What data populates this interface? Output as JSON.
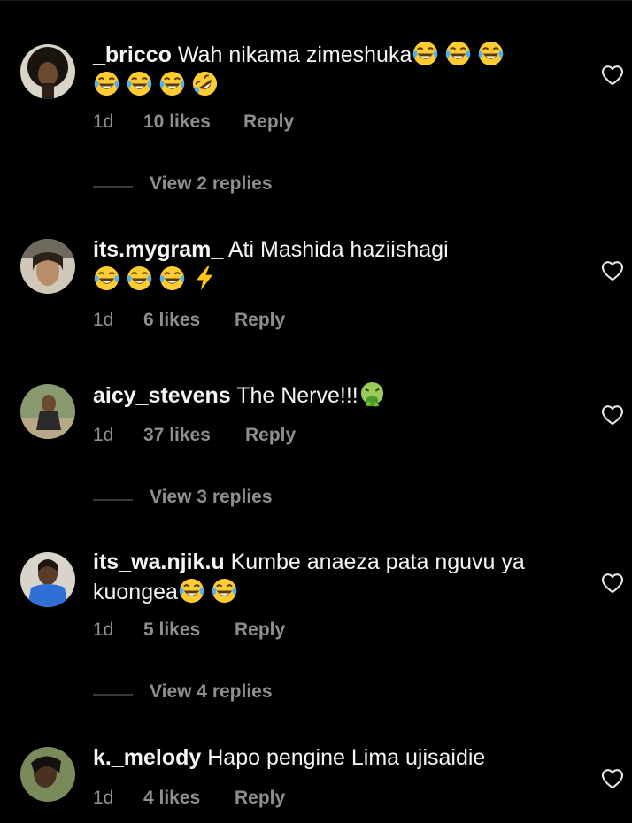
{
  "comments": [
    {
      "username": "_bricco",
      "text": "Wah nikama zimeshuka",
      "emojis_inline": [
        "tears-of-joy",
        "tears-of-joy",
        "tears-of-joy"
      ],
      "emojis_line2": [
        "tears-of-joy",
        "tears-of-joy",
        "tears-of-joy",
        "rofl"
      ],
      "time": "1d",
      "likes": "10 likes",
      "reply": "Reply",
      "view_replies": "View 2 replies"
    },
    {
      "username": "its.mygram_",
      "text": "Ati Mashida haziishagi",
      "emojis_line2": [
        "tears-of-joy",
        "tears-of-joy",
        "tears-of-joy",
        "high-voltage"
      ],
      "time": "1d",
      "likes": "6 likes",
      "reply": "Reply"
    },
    {
      "username": "aicy_stevens",
      "text": "The Nerve!!!",
      "emojis_inline": [
        "vomiting-face"
      ],
      "time": "1d",
      "likes": "37 likes",
      "reply": "Reply",
      "view_replies": "View 3 replies"
    },
    {
      "username": "its_wa.njik.u",
      "text": "Kumbe anaeza pata nguvu ya",
      "text_line2": "kuongea",
      "emojis_line2": [
        "tears-of-joy",
        "tears-of-joy"
      ],
      "time": "1d",
      "likes": "5 likes",
      "reply": "Reply",
      "view_replies": "View 4 replies"
    },
    {
      "username": "k._melody",
      "text": "Hapo pengine Lima ujisaidie",
      "time": "1d",
      "likes": "4 likes",
      "reply": "Reply"
    }
  ],
  "icons": {
    "like": "heart-outline-icon"
  },
  "colors": {
    "background": "#000000",
    "text": "#f5f5f5",
    "muted": "#8e8e8e"
  }
}
